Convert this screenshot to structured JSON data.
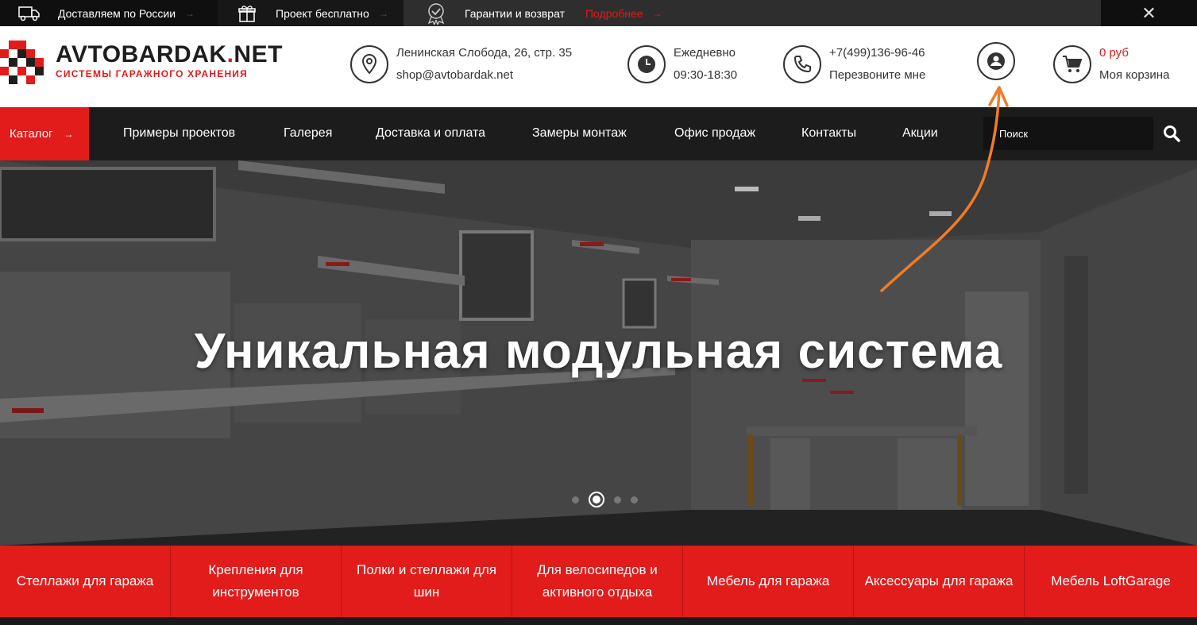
{
  "topbar": {
    "delivery": "Доставляем по России",
    "project": "Проект бесплатно",
    "guarantee": "Гарантии и возврат",
    "more": "Подробнее",
    "arrow": "→",
    "close": "✕"
  },
  "logo": {
    "title_main": "AVTOBARDAK",
    "title_dot": ".",
    "title_tld": "NET",
    "subtitle": "СИСТЕМЫ ГАРАЖНОГО ХРАНЕНИЯ"
  },
  "header": {
    "address": "Ленинская Слобода, 26, стр. 35",
    "email": "shop@avtobardak.net",
    "hours_label": "Ежедневно",
    "hours": "09:30-18:30",
    "phone": "+7(499)136-96-46",
    "callback": "Перезвоните мне",
    "cart_total": "0 руб",
    "cart_label": "Моя корзина"
  },
  "nav": {
    "catalog": "Каталог",
    "arrow": "→",
    "items": [
      "Примеры проектов",
      "Галерея",
      "Доставка и оплата",
      "Замеры монтаж",
      "Офис продаж",
      "Контакты",
      "Акции"
    ],
    "search_placeholder": "Поиск"
  },
  "hero": {
    "title": "Уникальная модульная система",
    "slides_count": 4,
    "active_slide": 2
  },
  "categories": [
    "Стеллажи для гаража",
    "Крепления для инструментов",
    "Полки и стеллажи для шин",
    "Для велосипедов и активного отдыха",
    "Мебель для гаража",
    "Аксессуары для гаража",
    "Мебель LoftGarage"
  ],
  "colors": {
    "accent": "#e21b1b",
    "dark": "#1c1c1c",
    "annotation": "#f07c28"
  }
}
